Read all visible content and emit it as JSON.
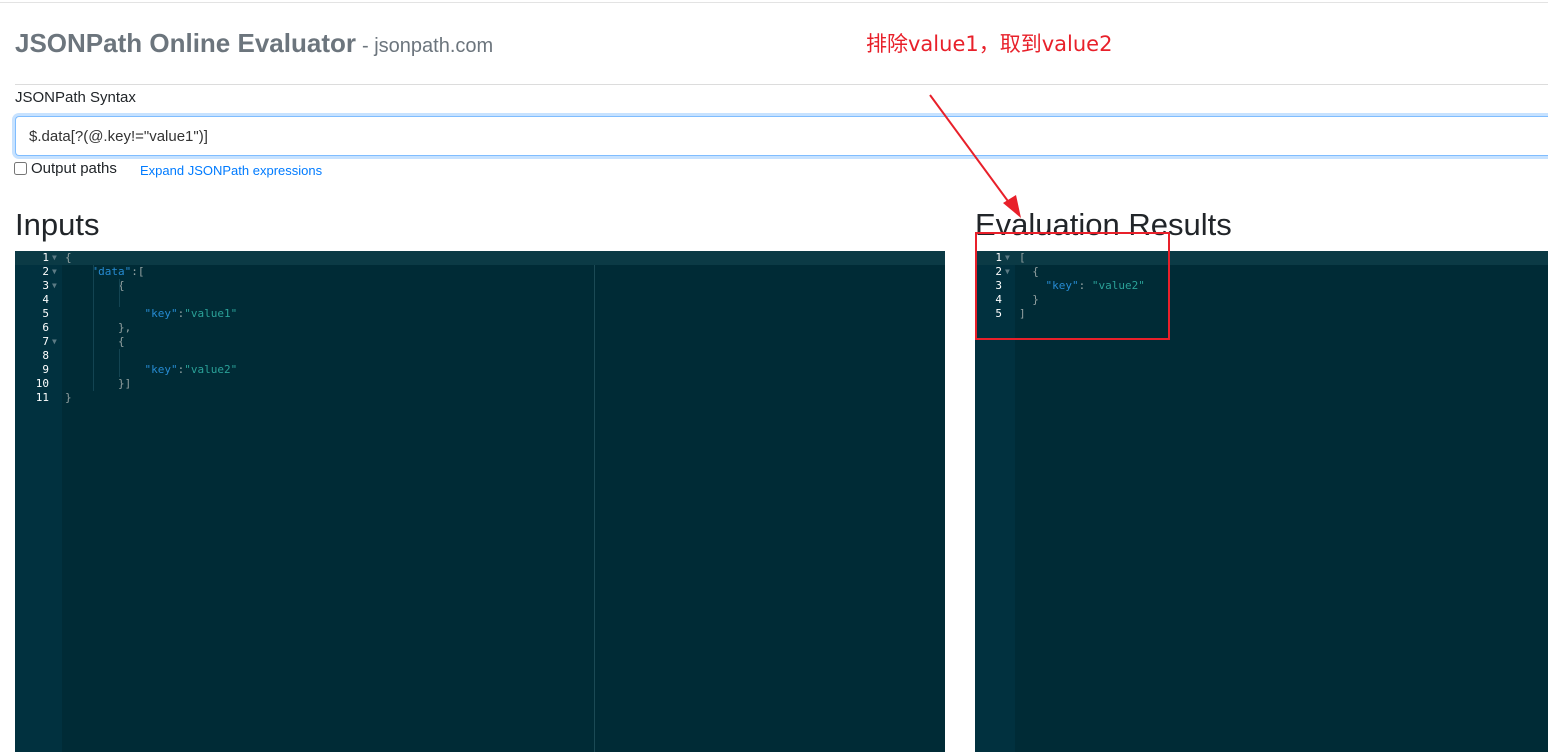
{
  "header": {
    "title": "JSONPath Online Evaluator",
    "subtitle": "- jsonpath.com"
  },
  "annotation": {
    "text": "排除value1，取到value2",
    "color": "#e8202a"
  },
  "syntax": {
    "label": "JSONPath Syntax",
    "value": "$.data[?(@.key!=\"value1\")]"
  },
  "options": {
    "output_paths_label": "Output paths",
    "output_paths_checked": false,
    "expand_link": "Expand JSONPath expressions"
  },
  "inputs": {
    "title": "Inputs",
    "line_numbers": [
      "1",
      "2",
      "3",
      "4",
      "5",
      "6",
      "7",
      "8",
      "9",
      "10",
      "11"
    ],
    "lines": [
      [
        {
          "t": "p",
          "v": "{"
        }
      ],
      [
        {
          "t": "p",
          "v": "    "
        },
        {
          "t": "k",
          "v": "\"data\""
        },
        {
          "t": "p",
          "v": ":["
        }
      ],
      [
        {
          "t": "p",
          "v": "        {"
        }
      ],
      [
        {
          "t": "p",
          "v": ""
        }
      ],
      [
        {
          "t": "p",
          "v": "            "
        },
        {
          "t": "k",
          "v": "\"key\""
        },
        {
          "t": "p",
          "v": ":"
        },
        {
          "t": "s",
          "v": "\"value1\""
        }
      ],
      [
        {
          "t": "p",
          "v": "        },"
        }
      ],
      [
        {
          "t": "p",
          "v": "        {"
        }
      ],
      [
        {
          "t": "p",
          "v": ""
        }
      ],
      [
        {
          "t": "p",
          "v": "            "
        },
        {
          "t": "k",
          "v": "\"key\""
        },
        {
          "t": "p",
          "v": ":"
        },
        {
          "t": "s",
          "v": "\"value2\""
        }
      ],
      [
        {
          "t": "p",
          "v": "        }]"
        }
      ],
      [
        {
          "t": "p",
          "v": "}"
        }
      ]
    ]
  },
  "results": {
    "title": "Evaluation Results",
    "line_numbers": [
      "1",
      "2",
      "3",
      "4",
      "5"
    ],
    "lines": [
      [
        {
          "t": "p",
          "v": "["
        }
      ],
      [
        {
          "t": "p",
          "v": "  {"
        }
      ],
      [
        {
          "t": "p",
          "v": "    "
        },
        {
          "t": "k",
          "v": "\"key\""
        },
        {
          "t": "p",
          "v": ": "
        },
        {
          "t": "s",
          "v": "\"value2\""
        }
      ],
      [
        {
          "t": "p",
          "v": "  }"
        }
      ],
      [
        {
          "t": "p",
          "v": "]"
        }
      ]
    ]
  },
  "theme": {
    "editor_bg": "#002b36",
    "key_color": "#268bd2",
    "string_color": "#2aa198",
    "link_color": "#007bff"
  }
}
